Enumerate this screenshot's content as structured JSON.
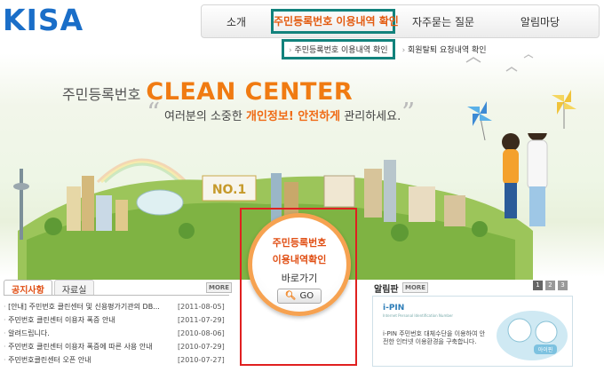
{
  "logo": "KISA",
  "nav": {
    "items": [
      "소개",
      "주민등록번호 이용내역 확인",
      "자주묻는 질문",
      "알림마당"
    ]
  },
  "sub_nav": {
    "items": [
      "주민등록번호 이용내역 확인",
      "회원탈퇴 요청내역 확인"
    ]
  },
  "headline": {
    "kr": "주민등록번호",
    "en": "CLEAN CENTER"
  },
  "quote": {
    "part1": "여러분의 소중한 ",
    "highlight": "개인정보! 안전하게",
    "part2": " 관리하세요."
  },
  "scene": {
    "sign_text": "NO.1"
  },
  "go_panel": {
    "line1": "주민등록번호",
    "line2": "이용내역확인",
    "line3": "바로가기",
    "button": "GO"
  },
  "notice": {
    "tabs": [
      "공지사항",
      "자료실"
    ],
    "more": "MORE",
    "items": [
      {
        "title": "[안내] 주민번호 클린센터 및 신용평가기관의 DB...",
        "date": "[2011-08-05]"
      },
      {
        "title": "주민번호 클린센터 이용자 폭증 안내",
        "date": "[2011-07-29]"
      },
      {
        "title": "알려드립니다.",
        "date": "[2010-08-06]"
      },
      {
        "title": "주민번호 클린센터 이용자 폭증에 따른 사용 안내",
        "date": "[2010-07-29]"
      },
      {
        "title": "주민번호클린센터 오픈 안내",
        "date": "[2010-07-27]"
      }
    ]
  },
  "board": {
    "title": "알림판",
    "more": "MORE",
    "pages": [
      "1",
      "2",
      "3"
    ],
    "ipin_logo": "i-PIN",
    "ipin_sub": "Internet Personal Identification Number",
    "ipin_text": "i-PIN 주민번호 대체수단을 이용하여 안전한 인터넷 이용환경을 구축합니다.",
    "ipin_badge": "아이핀"
  },
  "colors": {
    "accent": "#f07b12",
    "nav_highlight": "#12827c",
    "callout": "#e02020",
    "logo": "#1a6ec8"
  }
}
